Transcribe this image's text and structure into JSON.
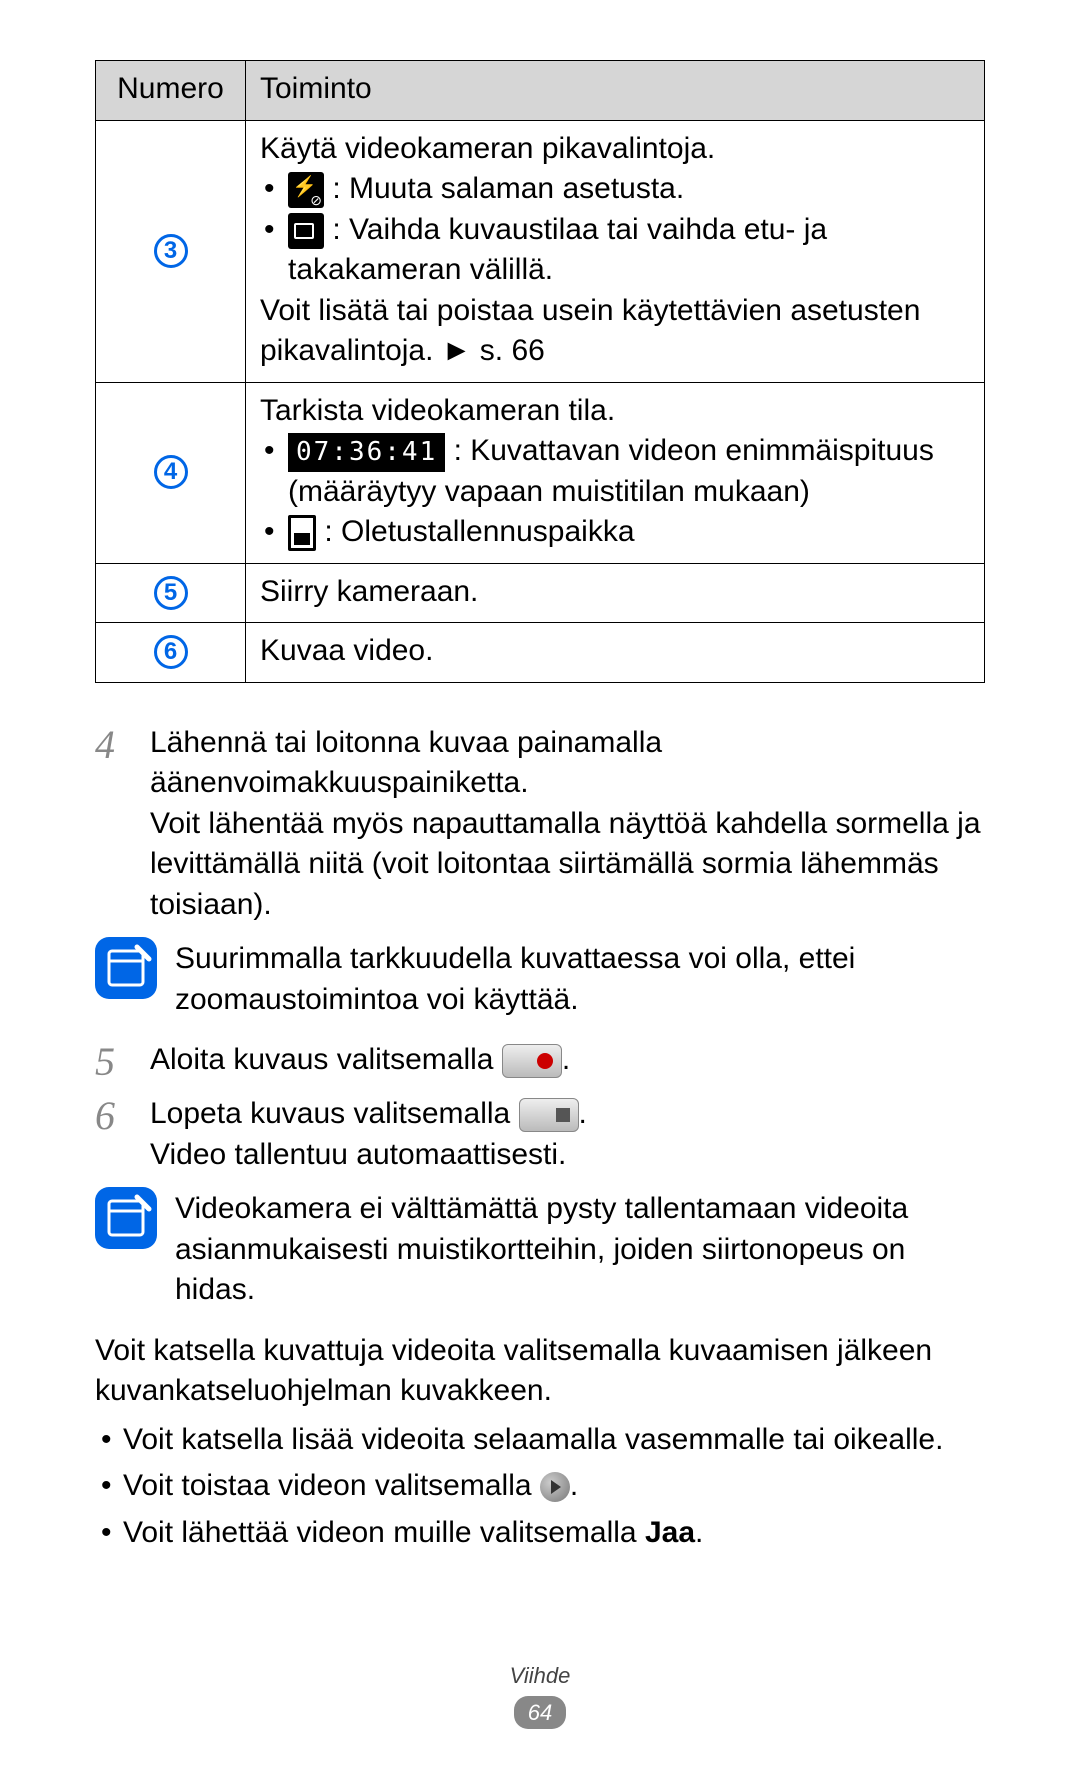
{
  "table": {
    "headers": {
      "num": "Numero",
      "func": "Toiminto"
    },
    "rows": [
      {
        "badge": "3",
        "intro": "Käytä videokameran pikavalintoja.",
        "b1_after": " : Muuta salaman asetusta.",
        "b2_after": " : Vaihda kuvaustilaa tai vaihda etu- ja takakameran välillä.",
        "outro": "Voit lisätä tai poistaa usein käytettävien asetusten pikavalintoja. ► s. 66"
      },
      {
        "badge": "4",
        "intro": "Tarkista videokameran tila.",
        "timecode": "07:36:41",
        "b1_after": " : Kuvattavan videon enimmäispituus (määräytyy vapaan muistitilan mukaan)",
        "b2_after": " : Oletustallennuspaikka"
      },
      {
        "badge": "5",
        "text": "Siirry kameraan."
      },
      {
        "badge": "6",
        "text": "Kuvaa video."
      }
    ]
  },
  "steps": {
    "s4": {
      "num": "4",
      "p1": "Lähennä tai loitonna kuvaa painamalla äänenvoimakkuuspainiketta.",
      "p2": "Voit lähentää myös napauttamalla näyttöä kahdella sormella ja levittämällä niitä (voit loitontaa siirtämällä sormia lähemmäs toisiaan)."
    },
    "note1": "Suurimmalla tarkkuudella kuvattaessa voi olla, ettei zoomaustoimintoa voi käyttää.",
    "s5": {
      "num": "5",
      "before": "Aloita kuvaus valitsemalla ",
      "after": "."
    },
    "s6": {
      "num": "6",
      "before": "Lopeta kuvaus valitsemalla ",
      "after": ".",
      "p2": "Video tallentuu automaattisesti."
    },
    "note2": "Videokamera ei välttämättä pysty tallentamaan videoita asianmukaisesti muistikortteihin, joiden siirtonopeus on hidas."
  },
  "body": {
    "p1": "Voit katsella kuvattuja videoita valitsemalla kuvaamisen jälkeen kuvankatseluohjelman kuvakkeen.",
    "li1": "Voit katsella lisää videoita selaamalla vasemmalle tai oikealle.",
    "li2_before": "Voit toistaa videon valitsemalla ",
    "li2_after": ".",
    "li3_before": "Voit lähettää videon muille valitsemalla ",
    "li3_bold": "Jaa",
    "li3_after": "."
  },
  "footer": {
    "cat": "Viihde",
    "page": "64"
  }
}
